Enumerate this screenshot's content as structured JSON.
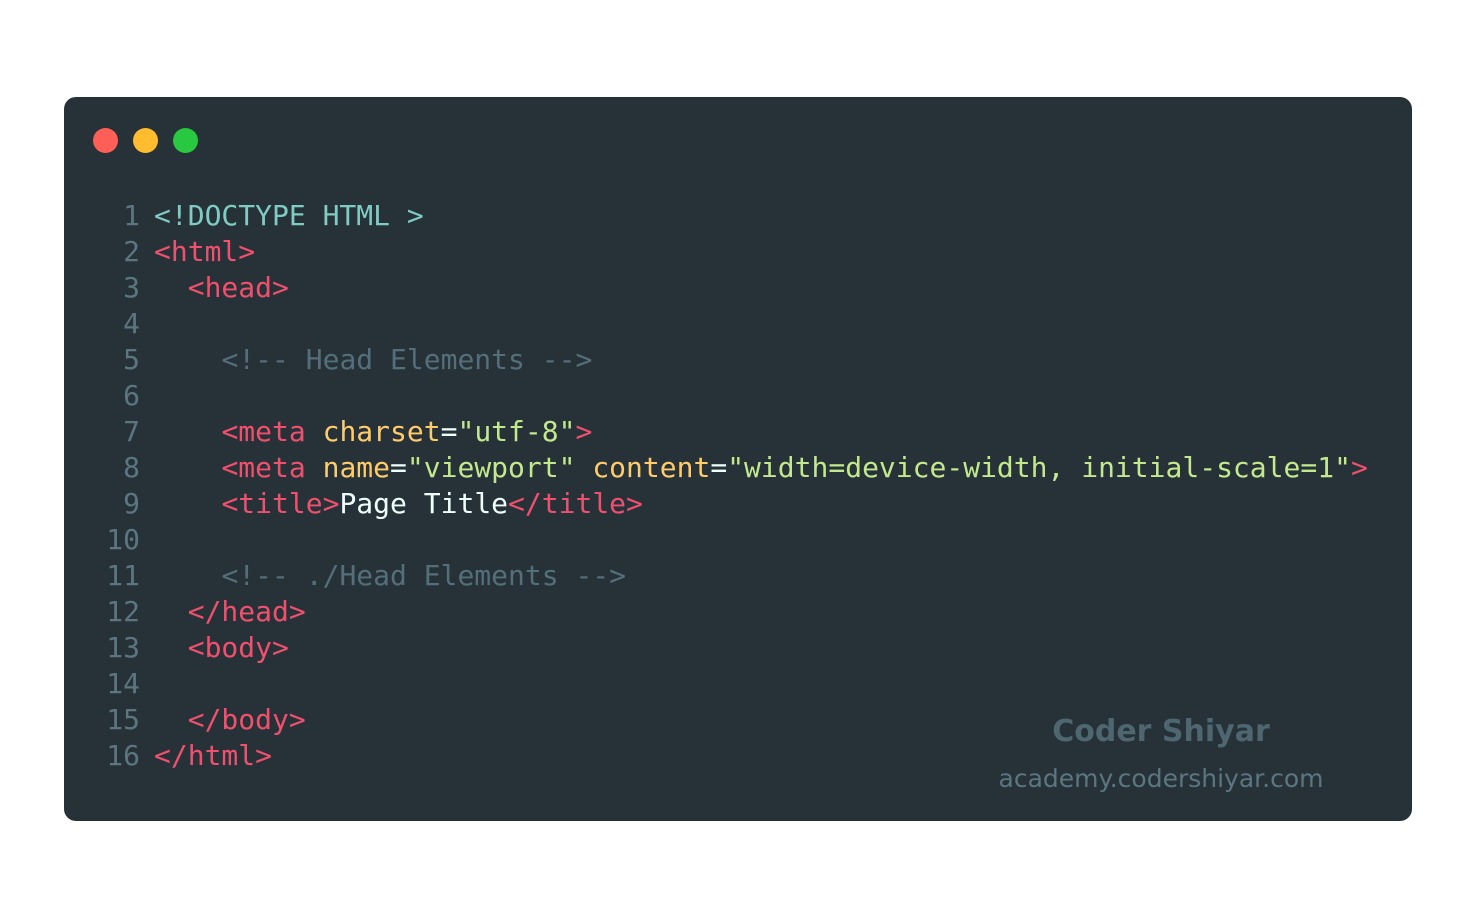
{
  "window": {
    "background": "#263238",
    "traffic_lights": [
      {
        "name": "close",
        "color": "#ff5f57"
      },
      {
        "name": "minimize",
        "color": "#febc2e"
      },
      {
        "name": "maximize",
        "color": "#28c840"
      }
    ]
  },
  "colors": {
    "doctype": "#80cbc4",
    "tag": "#f0506e",
    "attribute": "#ffcb6b",
    "string": "#c3e88d",
    "comment": "#546e7a",
    "text": "#eeffff",
    "line_number": "#5b7680"
  },
  "code": {
    "lines": [
      {
        "number": "1",
        "tokens": [
          {
            "type": "doctype",
            "text": "<!DOCTYPE HTML >"
          }
        ]
      },
      {
        "number": "2",
        "tokens": [
          {
            "type": "tag",
            "text": "<html>"
          }
        ]
      },
      {
        "number": "3",
        "tokens": [
          {
            "type": "plain",
            "text": "  "
          },
          {
            "type": "tag",
            "text": "<head>"
          }
        ]
      },
      {
        "number": "4",
        "tokens": []
      },
      {
        "number": "5",
        "tokens": [
          {
            "type": "plain",
            "text": "    "
          },
          {
            "type": "comment",
            "text": "<!-- Head Elements -->"
          }
        ]
      },
      {
        "number": "6",
        "tokens": []
      },
      {
        "number": "7",
        "tokens": [
          {
            "type": "plain",
            "text": "    "
          },
          {
            "type": "tag",
            "text": "<meta"
          },
          {
            "type": "plain",
            "text": " "
          },
          {
            "type": "attr",
            "text": "charset"
          },
          {
            "type": "plain",
            "text": "="
          },
          {
            "type": "str",
            "text": "\"utf-8\""
          },
          {
            "type": "tag",
            "text": ">"
          }
        ]
      },
      {
        "number": "8",
        "tokens": [
          {
            "type": "plain",
            "text": "    "
          },
          {
            "type": "tag",
            "text": "<meta"
          },
          {
            "type": "plain",
            "text": " "
          },
          {
            "type": "attr",
            "text": "name"
          },
          {
            "type": "plain",
            "text": "="
          },
          {
            "type": "str",
            "text": "\"viewport\""
          },
          {
            "type": "plain",
            "text": " "
          },
          {
            "type": "attr",
            "text": "content"
          },
          {
            "type": "plain",
            "text": "="
          },
          {
            "type": "str",
            "text": "\"width=device-width, initial-scale=1\""
          },
          {
            "type": "tag",
            "text": ">"
          }
        ]
      },
      {
        "number": "9",
        "tokens": [
          {
            "type": "plain",
            "text": "    "
          },
          {
            "type": "tag",
            "text": "<title>"
          },
          {
            "type": "text",
            "text": "Page Title"
          },
          {
            "type": "tag",
            "text": "</title>"
          }
        ]
      },
      {
        "number": "10",
        "tokens": []
      },
      {
        "number": "11",
        "tokens": [
          {
            "type": "plain",
            "text": "    "
          },
          {
            "type": "comment",
            "text": "<!-- ./Head Elements -->"
          }
        ]
      },
      {
        "number": "12",
        "tokens": [
          {
            "type": "plain",
            "text": "  "
          },
          {
            "type": "tag",
            "text": "</head>"
          }
        ]
      },
      {
        "number": "13",
        "tokens": [
          {
            "type": "plain",
            "text": "  "
          },
          {
            "type": "tag",
            "text": "<body>"
          }
        ]
      },
      {
        "number": "14",
        "tokens": []
      },
      {
        "number": "15",
        "tokens": [
          {
            "type": "plain",
            "text": "  "
          },
          {
            "type": "tag",
            "text": "</body>"
          }
        ]
      },
      {
        "number": "16",
        "tokens": [
          {
            "type": "tag",
            "text": "</html>"
          }
        ]
      }
    ]
  },
  "watermark": {
    "brand": "Coder Shiyar",
    "site": "academy.codershiyar.com"
  }
}
